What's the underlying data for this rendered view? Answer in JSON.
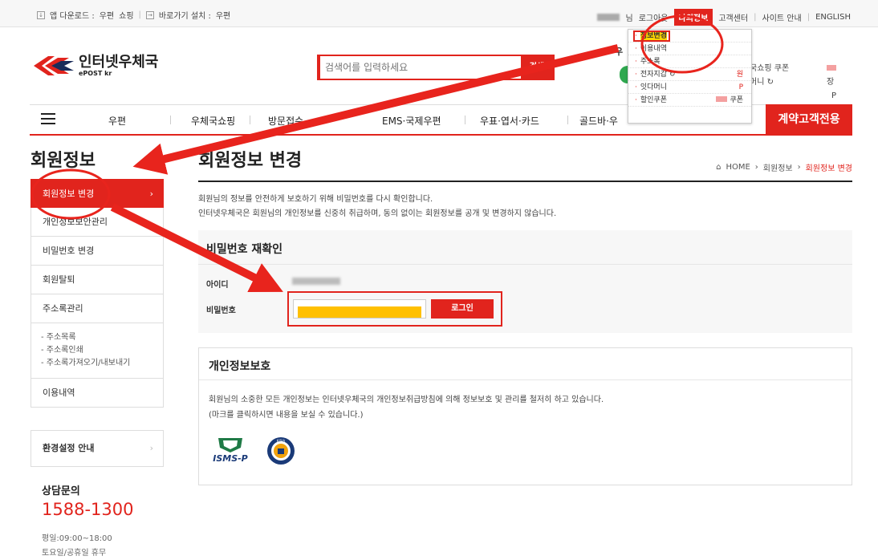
{
  "topbar": {
    "app_download": "앱 다운로드 :",
    "app_post": "우편",
    "app_shop": "쇼핑",
    "shortcut": "바로가기 설치 :",
    "shortcut_post": "우편",
    "user_suffix": "님",
    "logout": "로그아웃",
    "my_info": "나의정보",
    "customer_center": "고객센터",
    "sitemap": "사이트 안내",
    "english": "ENGLISH"
  },
  "dropdown": {
    "items": [
      {
        "label": "정보변경"
      },
      {
        "label": "이용내역"
      },
      {
        "label": "주소록"
      },
      {
        "label": "전자지갑",
        "value": "원"
      },
      {
        "label": "잇다머니",
        "value": "P"
      },
      {
        "label": "할인쿠폰",
        "value": "쿠폰"
      }
    ]
  },
  "header": {
    "logo_name": "인터넷우체국",
    "logo_sub": "ePOST kr",
    "search_placeholder": "검색어를 입력하세요",
    "search_button": "검색",
    "user_initial": "우",
    "shop_coupon": "국쇼핑 쿠폰",
    "shop_coupon_unit": "장",
    "money": "머니",
    "money_unit": "P"
  },
  "nav": {
    "items": [
      "우편",
      "우체국쇼핑",
      "방문접수",
      "EMS·국제우편",
      "우표·엽서·카드",
      "골드바·우"
    ],
    "cta": "계약고객전용"
  },
  "sidebar": {
    "title": "회원정보",
    "items": [
      "회원정보 변경",
      "개인정보보안관리",
      "비밀번호 변경",
      "회원탈퇴",
      "주소록관리"
    ],
    "sub_items": [
      "- 주소목록",
      "- 주소록인쇄",
      "- 주소록가져오기/내보내기"
    ],
    "last_item": "이용내역",
    "env": "환경설정 안내",
    "cs_title": "상담문의",
    "cs_phone": "1588-1300",
    "cs_hours1": "평일:09:00~18:00",
    "cs_hours2": "토요일/공휴일 휴무"
  },
  "main": {
    "title": "회원정보 변경",
    "breadcrumb": [
      "HOME",
      "회원정보",
      "회원정보 변경"
    ],
    "desc1": "회원님의 정보를 안전하게 보호하기 위해 비밀번호를 다시 확인합니다.",
    "desc2": "인터넷우체국은 회원님의 개인정보를 신중히 취급하며, 동의 없이는 회원정보를 공개 및 변경하지 않습니다.",
    "pw_section_title": "비밀번호 재확인",
    "id_label": "아이디",
    "pw_label": "비밀번호",
    "login_button": "로그인",
    "privacy_title": "개인정보보호",
    "privacy_text1": "회원님의 소중한 모든 개인정보는 인터넷우체국의 개인정보취급방침에 의해 정보보호 및 관리를 철저히 하고 있습니다.",
    "privacy_text2": "(마크를 클릭하시면 내용을 보실 수 있습니다.)",
    "isms_label": "ISMS-P",
    "kisia_label": "KISIA"
  },
  "colors": {
    "accent": "#e1241d",
    "highlight": "#ffd400",
    "password_fill": "#ffc000"
  }
}
